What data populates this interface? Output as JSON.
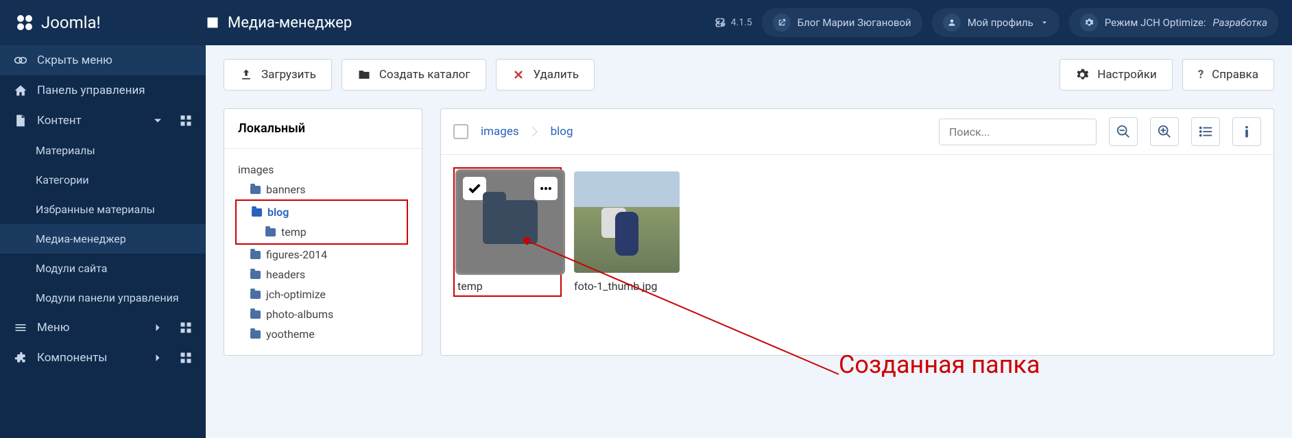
{
  "header": {
    "logo": "Joomla!",
    "title": "Медиа-менеджер",
    "version": "4.1.5",
    "blog_btn": "Блог Марии Зюгановой",
    "profile_btn": "Мой профиль",
    "mode_btn_prefix": "Режим JCH Optimize: ",
    "mode_btn_value": "Разработка"
  },
  "sidebar": {
    "hide": "Скрыть меню",
    "dashboard": "Панель управления",
    "content": "Контент",
    "content_items": [
      "Материалы",
      "Категории",
      "Избранные материалы",
      "Медиа-менеджер",
      "Модули сайта",
      "Модули панели управления"
    ],
    "menu": "Меню",
    "components": "Компоненты"
  },
  "toolbar": {
    "upload": "Загрузить",
    "create": "Создать каталог",
    "delete": "Удалить",
    "settings": "Настройки",
    "help": "Справка"
  },
  "tree": {
    "title": "Локальный",
    "root": "images",
    "items": [
      "banners",
      "blog",
      "temp",
      "figures-2014",
      "headers",
      "jch-optimize",
      "photo-albums",
      "yootheme"
    ]
  },
  "browser": {
    "crumb1": "images",
    "crumb2": "blog",
    "search_ph": "Поиск...",
    "folder_label": "temp",
    "image_label": "foto-1_thumb.jpg"
  },
  "annotation": "Созданная папка"
}
